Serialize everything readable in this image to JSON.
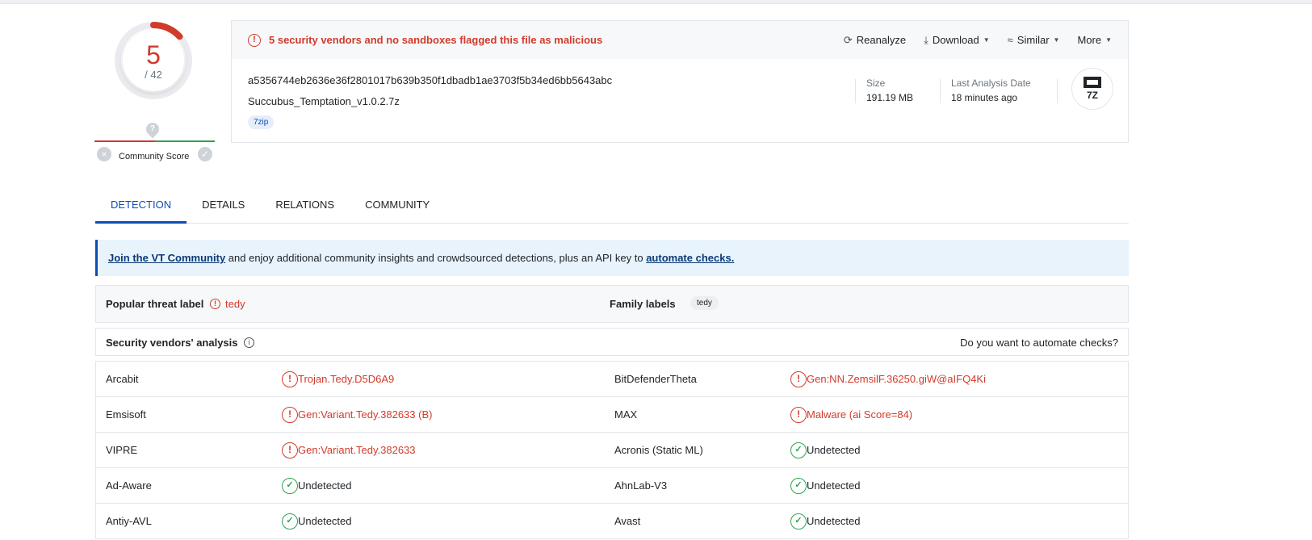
{
  "score": {
    "detections": "5",
    "total": "/ 42"
  },
  "community": {
    "label": "Community Score",
    "x_icon": "×",
    "check_icon": "✓",
    "pin_icon": "?"
  },
  "alert": {
    "icon": "!",
    "text": "5 security vendors and no sandboxes flagged this file as malicious"
  },
  "actions": [
    {
      "icon": "⟳",
      "label": "Reanalyze",
      "caret": ""
    },
    {
      "icon": "⤓",
      "label": "Download",
      "caret": "▼"
    },
    {
      "icon": "≈",
      "label": "Similar",
      "caret": "▼"
    },
    {
      "icon": "",
      "label": "More",
      "caret": "▼"
    }
  ],
  "file": {
    "hash": "a5356744eb2636e36f2801017b639b350f1dbadb1ae3703f5b34ed6bb5643abc",
    "name": "Succubus_Temptation_v1.0.2.7z",
    "tag": "7zip",
    "size_label": "Size",
    "size_value": "191.19 MB",
    "date_label": "Last Analysis Date",
    "date_value": "18 minutes ago",
    "type_text": "7Z"
  },
  "tabs": [
    "DETECTION",
    "DETAILS",
    "RELATIONS",
    "COMMUNITY"
  ],
  "banner": {
    "link1": "Join the VT Community",
    "middle": " and enjoy additional community insights and crowdsourced detections, plus an API key to ",
    "link2": "automate checks."
  },
  "labels": {
    "popular_title": "Popular threat label",
    "popular_value": "tedy",
    "family_title": "Family labels",
    "family_value": "tedy"
  },
  "vendors_header": {
    "title": "Security vendors' analysis",
    "info_icon": "i",
    "right_text": "Do you want to automate checks?"
  },
  "vendors": [
    {
      "left_name": "Arcabit",
      "left_result": "Trojan.Tedy.D5D6A9",
      "left_status": "mal",
      "right_name": "BitDefenderTheta",
      "right_result": "Gen:NN.ZemsilF.36250.giW@aIFQ4Ki",
      "right_status": "mal"
    },
    {
      "left_name": "Emsisoft",
      "left_result": "Gen:Variant.Tedy.382633 (B)",
      "left_status": "mal",
      "right_name": "MAX",
      "right_result": "Malware (ai Score=84)",
      "right_status": "mal"
    },
    {
      "left_name": "VIPRE",
      "left_result": "Gen:Variant.Tedy.382633",
      "left_status": "mal",
      "right_name": "Acronis (Static ML)",
      "right_result": "Undetected",
      "right_status": "ok"
    },
    {
      "left_name": "Ad-Aware",
      "left_result": "Undetected",
      "left_status": "ok",
      "right_name": "AhnLab-V3",
      "right_result": "Undetected",
      "right_status": "ok"
    },
    {
      "left_name": "Antiy-AVL",
      "left_result": "Undetected",
      "left_status": "ok",
      "right_name": "Avast",
      "right_result": "Undetected",
      "right_status": "ok"
    }
  ],
  "colors": {
    "malicious": "#d13b2b",
    "clean": "#2ea44f",
    "accent": "#0b4eb3"
  }
}
